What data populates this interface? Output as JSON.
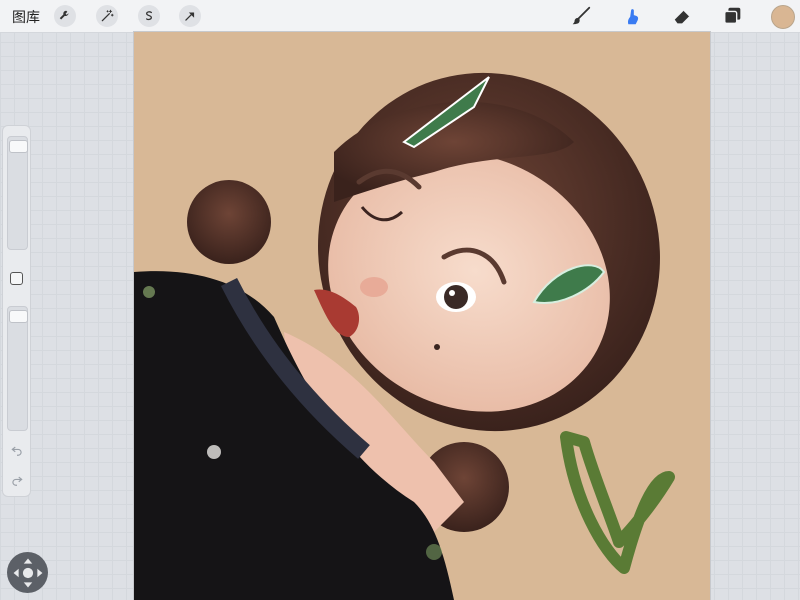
{
  "topbar": {
    "gallery_label": "图库",
    "left_tools": [
      "wrench-icon",
      "magic-wand-icon",
      "selection-s-icon",
      "transform-arrow-icon"
    ],
    "right_tools": [
      "brush-icon",
      "smudge-icon",
      "eraser-icon",
      "layers-icon"
    ],
    "active_tool": "smudge-icon",
    "current_color": "#d9b693",
    "accent": "#3a7bf2"
  },
  "sidebar": {
    "brush_size": 0.95,
    "opacity": 0.95,
    "undo_icon": "undo-icon",
    "redo_icon": "redo-icon"
  },
  "canvas": {
    "background": "#d8b896",
    "description_icon": "artwork-illustration"
  },
  "quickmenu": {
    "icon": "move-arrows-icon"
  }
}
